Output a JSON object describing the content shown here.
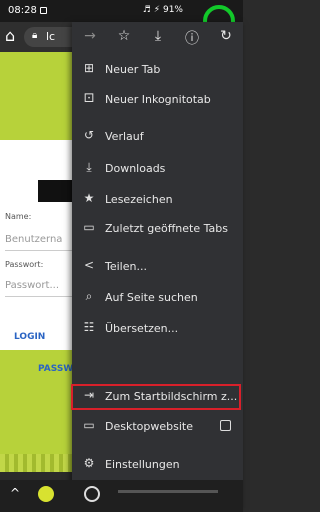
{
  "status_bar": {
    "time": "08:28",
    "right": "♬ ⚡ 91%"
  },
  "url_bar": {
    "text": "lc"
  },
  "page": {
    "name_label": "Name:",
    "name_placeholder": "Benutzerna",
    "password_label": "Passwort:",
    "password_placeholder": "Passwort...",
    "login": "LOGIN",
    "passw": "PASSW"
  },
  "menu_toolbar": [
    {
      "icon": "forward-icon",
      "glyph": "→"
    },
    {
      "icon": "star-icon",
      "glyph": "☆"
    },
    {
      "icon": "download-icon",
      "glyph": "⤓"
    },
    {
      "icon": "info-icon",
      "glyph": "ⓘ"
    },
    {
      "icon": "reload-icon",
      "glyph": "↻"
    }
  ],
  "menu_items": [
    {
      "label": "Neuer Tab",
      "icon": "new-tab-icon",
      "glyph": "⊞"
    },
    {
      "label": "Neuer Inkognitotab",
      "icon": "incognito-icon",
      "glyph": "⚀"
    },
    {
      "label": "Verlauf",
      "icon": "history-icon",
      "glyph": "↺"
    },
    {
      "label": "Downloads",
      "icon": "downloads-icon",
      "glyph": "⤓"
    },
    {
      "label": "Lesezeichen",
      "icon": "bookmarks-icon",
      "glyph": "★"
    },
    {
      "label": "Zuletzt geöffnete Tabs",
      "icon": "recent-tabs-icon",
      "glyph": "▭"
    },
    {
      "label": "Teilen...",
      "icon": "share-icon",
      "glyph": "<"
    },
    {
      "label": "Auf Seite suchen",
      "icon": "find-in-page-icon",
      "glyph": "⌕"
    },
    {
      "label": "Übersetzen...",
      "icon": "translate-icon",
      "glyph": "☷"
    },
    {
      "label": "Zum Startbildschirm z...",
      "icon": "add-to-home-icon",
      "glyph": "⇥"
    },
    {
      "label": "Desktopwebsite",
      "icon": "desktop-icon",
      "glyph": "▭"
    },
    {
      "label": "Einstellungen",
      "icon": "settings-icon",
      "glyph": "⚙"
    }
  ]
}
